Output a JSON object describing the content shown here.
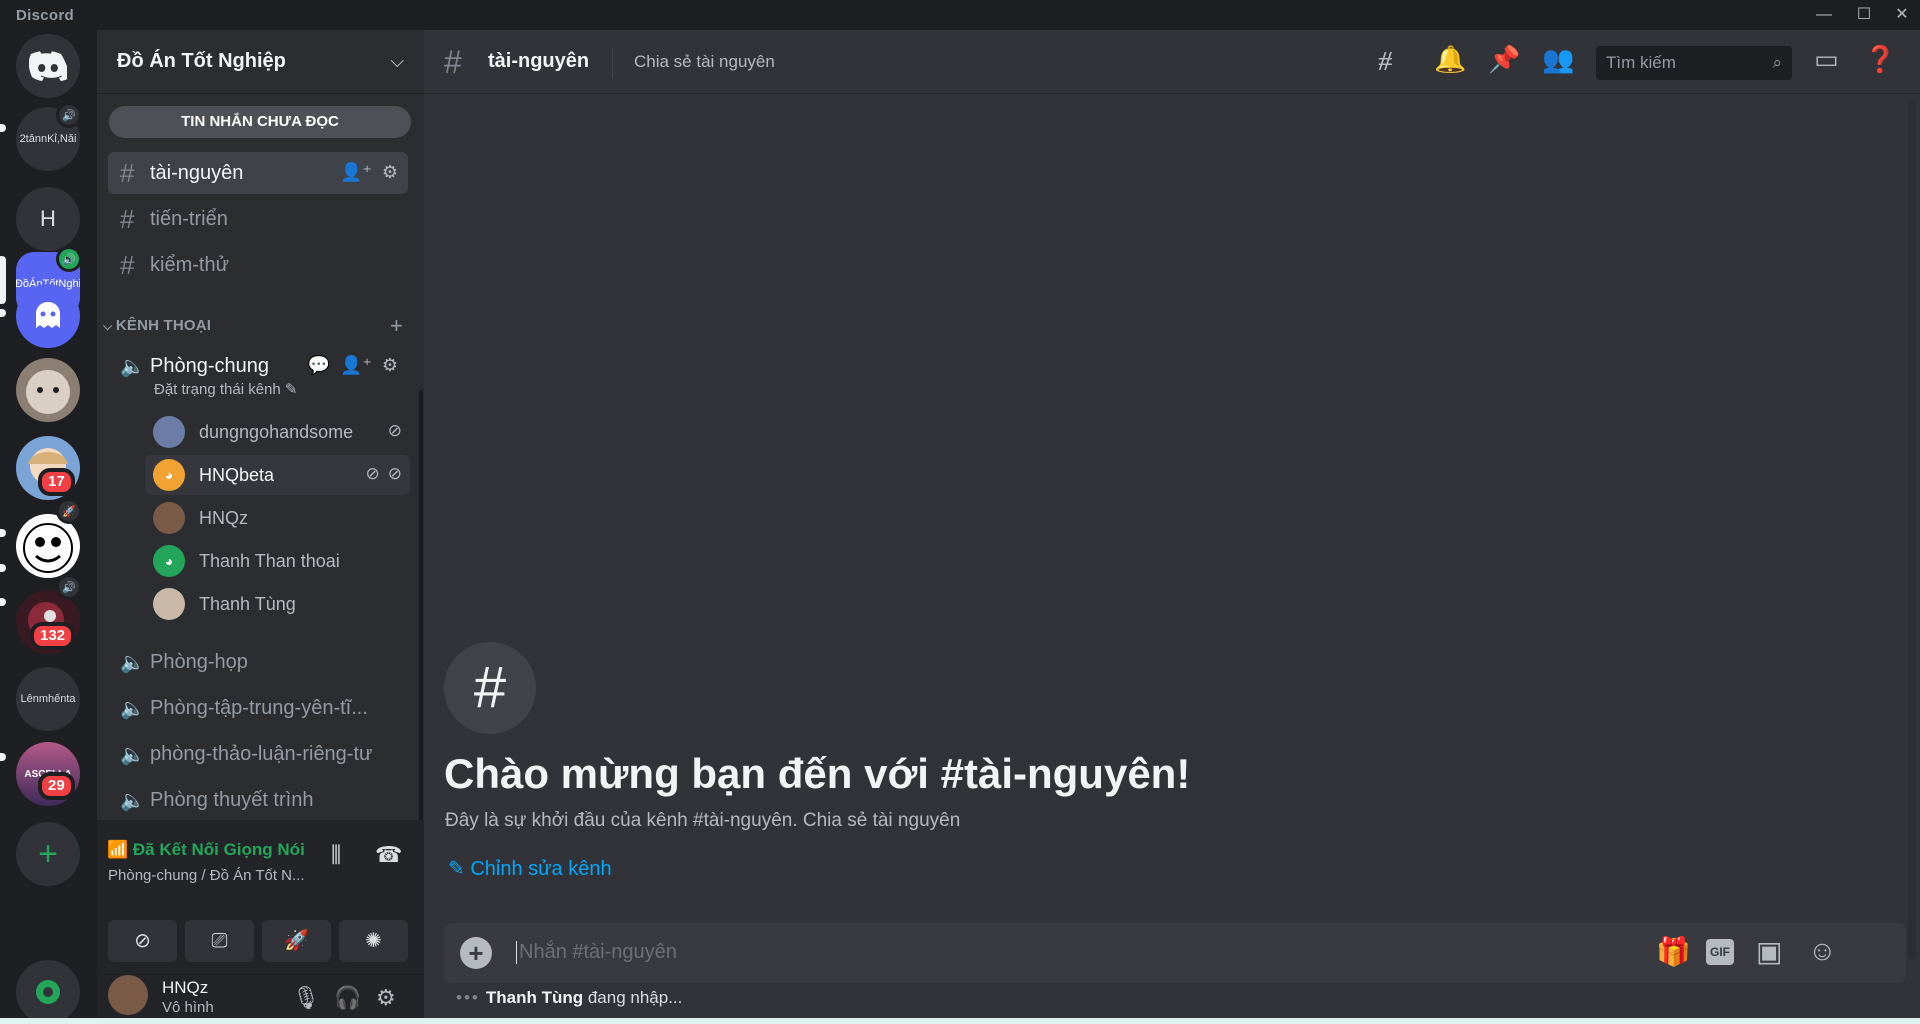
{
  "app": {
    "title": "Discord"
  },
  "window_controls": {
    "minimize": "—",
    "maximize": "☐",
    "close": "✕"
  },
  "servers": [
    {
      "label": "Discord Home",
      "icon": "discord-logo-icon"
    },
    {
      "label": "2tảnnKỉ,Năi",
      "has_voice": true
    },
    {
      "label": "H"
    },
    {
      "label": "ĐồÁnTốtNghi",
      "active": true,
      "has_voice": true
    },
    {
      "label": "",
      "icon": "ghost-icon"
    },
    {
      "label": "",
      "icon": "cat-avatar"
    },
    {
      "label": "",
      "icon": "anime-avatar",
      "badge": "17"
    },
    {
      "label": "",
      "icon": "cartoon-face",
      "has_boost": true
    },
    {
      "label": "",
      "icon": "dark-avatar",
      "badge": "132",
      "has_voice": true
    },
    {
      "label": "Lênmhếnta"
    },
    {
      "label": "ASCELLA",
      "badge": "29"
    },
    {
      "label": "+",
      "icon": "add-server-icon"
    },
    {
      "label": "",
      "icon": "discover-icon"
    }
  ],
  "guild": {
    "name": "Đồ Án Tốt Nghiệp",
    "unread_banner": "TIN NHẮN CHƯA ĐỌC",
    "text_channels": [
      {
        "name": "tài-nguyên",
        "selected": true
      },
      {
        "name": "tiến-triển"
      },
      {
        "name": "kiểm-thử"
      }
    ],
    "voice_category": "KÊNH THOẠI",
    "voice_channel": {
      "name": "Phòng-chung",
      "status": "Đặt trạng thái kênh",
      "users": [
        {
          "name": "dungngohandsome",
          "color": "#6b7da6"
        },
        {
          "name": "HNQbeta",
          "color": "#f0a232",
          "highlight": true
        },
        {
          "name": "HNQz",
          "color": "#7a5b48"
        },
        {
          "name": "Thanh Than thoai",
          "color": "#23a55a"
        },
        {
          "name": "Thanh Tùng",
          "color": "#c9b7a8"
        }
      ]
    },
    "other_voice_channels": [
      "Phòng-họp",
      "Phòng-tập-trung-yên-tĩ...",
      "phòng-thảo-luận-riêng-tư",
      "Phòng thuyết trình"
    ]
  },
  "voice_panel": {
    "status": "Đã Kết Nối Giọng Nói",
    "location": "Phòng-chung / Đồ Án Tốt N..."
  },
  "user_panel": {
    "name": "HNQz",
    "status": "Vô hình"
  },
  "header": {
    "channel": "tài-nguyên",
    "topic": "Chia sẻ tài nguyên",
    "search_placeholder": "Tìm kiếm"
  },
  "welcome": {
    "title": "Chào mừng bạn đến với #tài-nguyên!",
    "subtitle": "Đây là sự khởi đầu của kênh #tài-nguyên. Chia sẻ tài nguyên",
    "edit_link": "Chỉnh sửa kênh"
  },
  "composer": {
    "placeholder": "Nhắn #tài-nguyên",
    "gif_label": "GIF"
  },
  "typing": {
    "user": "Thanh Tùng",
    "text": " đang nhập..."
  },
  "colors": {
    "accent": "#5865f2",
    "online": "#23a55a",
    "link": "#00a8fc",
    "badge": "#f23f43"
  }
}
